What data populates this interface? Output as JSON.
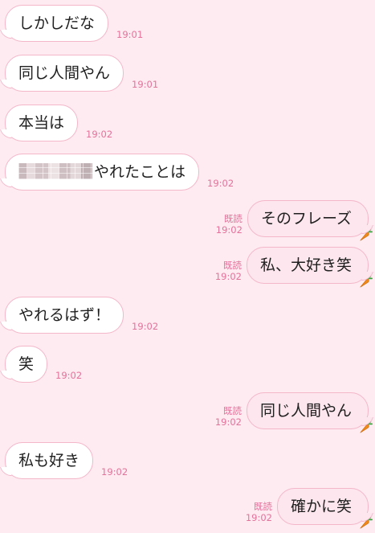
{
  "colors": {
    "background": "#fdebf1",
    "bubble_border": "#f4b6c9",
    "incoming_bubble": "#ffffff",
    "outgoing_bubble": "#fde6ee",
    "timestamp": "#e4729a"
  },
  "messages": [
    {
      "side": "left",
      "text": "しかしだな",
      "time": "19:01"
    },
    {
      "side": "left",
      "text": "同じ人間やん",
      "time": "19:01"
    },
    {
      "side": "left",
      "text": "本当は",
      "time": "19:02"
    },
    {
      "side": "left",
      "text": "やれたことは",
      "time": "19:02",
      "redacted": true
    },
    {
      "side": "right",
      "text": "そのフレーズ",
      "time": "19:02",
      "read": "既読",
      "reaction_icon": "carrot-icon"
    },
    {
      "side": "right",
      "text": "私、大好き笑",
      "time": "19:02",
      "read": "既読",
      "reaction_icon": "carrot-icon"
    },
    {
      "side": "left",
      "text": "やれるはず！",
      "time": "19:02"
    },
    {
      "side": "left",
      "text": "笑",
      "time": "19:02"
    },
    {
      "side": "right",
      "text": "同じ人間やん",
      "time": "19:02",
      "read": "既読",
      "reaction_icon": "carrot-icon"
    },
    {
      "side": "left",
      "text": "私も好き",
      "time": "19:02"
    },
    {
      "side": "right",
      "text": "確かに笑",
      "time": "19:02",
      "read": "既読",
      "reaction_icon": "carrot-icon"
    }
  ]
}
